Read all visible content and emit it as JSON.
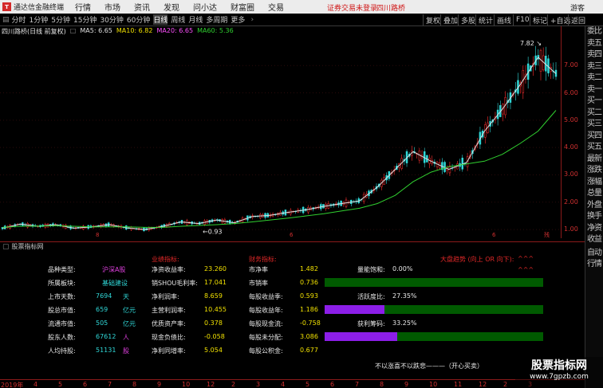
{
  "app": {
    "name": "通达信金融终端",
    "logo_text": "T"
  },
  "menu": [
    "行情",
    "市场",
    "资讯",
    "发现",
    "问小达",
    "财富圈",
    "交易"
  ],
  "alert": {
    "text": "证券交易未登录",
    "stock": "四川路桥"
  },
  "window_buttons": [
    "复权",
    "叠加",
    "多股",
    "统计",
    "画线",
    "F10",
    "标记",
    "+自选",
    "返回"
  ],
  "guest_label": "游客",
  "periods": [
    "分时",
    "1分钟",
    "5分钟",
    "15分钟",
    "30分钟",
    "60分钟",
    "日线",
    "周线",
    "月线",
    "多周期",
    "更多"
  ],
  "active_period": "日线",
  "chart_header": {
    "stock_title": "四川路桥(日线 前复权)",
    "ma5": "MA5: 6.65",
    "ma10": "MA10: 6.82",
    "ma20": "MA20: 6.65",
    "ma60": "MA60: 5.36"
  },
  "chart_data": {
    "type": "line",
    "title": "",
    "ylim": [
      0.8,
      8.2
    ],
    "y_ticks": [
      "7.00",
      "6.00",
      "5.00",
      "4.00",
      "3.00",
      "2.00",
      "1.00"
    ],
    "high_label": "7.82",
    "low_label": "0.93",
    "series": [
      {
        "name": "MA5",
        "color": "#e0e0e0",
        "values": [
          1.05,
          1.2,
          1.12,
          1.18,
          1.05,
          1.1,
          1.18,
          1.06,
          1.0,
          1.12,
          1.28,
          1.22,
          1.35,
          1.25,
          1.48,
          1.52,
          1.63,
          1.72,
          1.85,
          1.95,
          2.05,
          2.55,
          3.2,
          3.85,
          3.5,
          3.2,
          3.45,
          4.6,
          5.4,
          6.3,
          7.3,
          6.7
        ]
      },
      {
        "name": "MA60",
        "color": "#30d030",
        "values": [
          1.08,
          1.12,
          1.13,
          1.14,
          1.12,
          1.1,
          1.1,
          1.1,
          1.08,
          1.08,
          1.12,
          1.15,
          1.18,
          1.22,
          1.28,
          1.35,
          1.42,
          1.5,
          1.58,
          1.68,
          1.78,
          1.95,
          2.25,
          2.75,
          3.1,
          3.3,
          3.4,
          3.5,
          3.75,
          4.15,
          4.6,
          5.36
        ]
      }
    ]
  },
  "x_axis_markers": [
    "8",
    "6",
    "6",
    "残"
  ],
  "side_tabs": [
    "委比",
    "卖五",
    "卖四",
    "卖三",
    "卖二",
    "卖一",
    "买一",
    "买二",
    "买三",
    "买四",
    "买五",
    "最新",
    "涨跌",
    "涨幅",
    "总量",
    "外盘",
    "换手",
    "净资",
    "收益"
  ],
  "side_tabs_bottom": [
    "自动",
    "行情"
  ],
  "indicator_panel": {
    "title": "股票指标网",
    "sections": {
      "performance": "业绩指标:",
      "finance": "财务指标:",
      "trend": "大盘趋势 (向上 OR 向下):"
    },
    "trend_marks": [
      "^^^",
      "^^^"
    ],
    "left": [
      {
        "label": "品种类型:",
        "value": "沪深A股",
        "unit": ""
      },
      {
        "label": "所属板块:",
        "value": "基础建设",
        "unit": ""
      },
      {
        "label": "上市天数:",
        "value": "7694",
        "unit": "天"
      },
      {
        "label": "股总市值:",
        "value": "659",
        "unit": "亿元"
      },
      {
        "label": "流通市值:",
        "value": "505",
        "unit": "亿元"
      },
      {
        "label": "股东人数:",
        "value": "67612",
        "unit": "人"
      },
      {
        "label": "人均持股:",
        "value": "51131",
        "unit": "股"
      }
    ],
    "middle": [
      {
        "label": "净资收益率:",
        "value": "23.260"
      },
      {
        "label": "销SHOU毛利率:",
        "value": "17.041"
      },
      {
        "label": "净利润率:",
        "value": "8.659"
      },
      {
        "label": "主营利润率:",
        "value": "10.455"
      },
      {
        "label": "优质资产率:",
        "value": "0.378"
      },
      {
        "label": "现金负债比:",
        "value": "-0.058"
      },
      {
        "label": "净利同增率:",
        "value": "5.054"
      }
    ],
    "right": [
      {
        "label": "市净率",
        "value": "1.482"
      },
      {
        "label": "市销率",
        "value": "0.736"
      },
      {
        "label": "每股收益季:",
        "value": "0.593"
      },
      {
        "label": "每股收益年:",
        "value": "1.186"
      },
      {
        "label": "每股现金流:",
        "value": "-0.758"
      },
      {
        "label": "每股未分配:",
        "value": "3.086"
      },
      {
        "label": "每股公积金:",
        "value": "0.677"
      }
    ],
    "bars": [
      {
        "label": "量能饱和:",
        "text": "0.00%",
        "fraction": 0.0
      },
      {
        "label": "活跃度比:",
        "text": "27.35%",
        "fraction": 0.2735
      },
      {
        "label": "获利筹码:",
        "text": "33.25%",
        "fraction": 0.3325
      }
    ],
    "motto": "不以涨喜不以跌悲———（开心买卖）"
  },
  "bottom_axis": {
    "year": "2019年",
    "ticks": [
      "4",
      "5",
      "6",
      "7",
      "8",
      "9",
      "10",
      "12",
      "2",
      "3",
      "4",
      "5",
      "6",
      "7",
      "8",
      "9",
      "10",
      "11",
      "12",
      "2",
      "3"
    ]
  },
  "watermark": {
    "line1": "股票指标网",
    "line2": "www.7gpzb.com"
  }
}
